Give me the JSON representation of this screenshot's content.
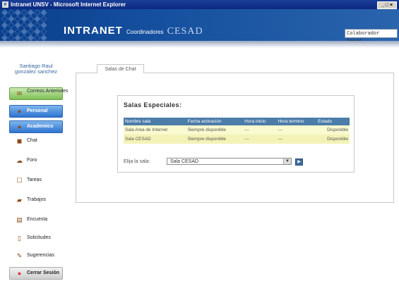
{
  "window": {
    "title": "Intranet UNSV - Microsoft Internet Explorer",
    "controls": "_ □ ×"
  },
  "banner": {
    "brand": "INTRANET",
    "subtitle": "Coordinadores",
    "cesad": "CESAD",
    "user": "Colaborador Cesad"
  },
  "sidebar": {
    "user_name_line1": "Santiago Raul",
    "user_name_line2": "gonzalez sanchez",
    "items": [
      {
        "label": "Correos Anteriores",
        "icon": "mail-icon"
      },
      {
        "label": "Personal",
        "icon": "person-icon"
      },
      {
        "label": "Academico",
        "icon": "book-icon"
      },
      {
        "label": "Chat",
        "icon": "chat-icon"
      },
      {
        "label": "Foro",
        "icon": "forum-icon"
      },
      {
        "label": "Tareas",
        "icon": "tasks-icon"
      },
      {
        "label": "Trabajos",
        "icon": "works-icon"
      },
      {
        "label": "Encuesta",
        "icon": "survey-icon"
      },
      {
        "label": "Solicitudes",
        "icon": "requests-icon"
      },
      {
        "label": "Sugerencias",
        "icon": "suggestions-icon"
      },
      {
        "label": "Cerrar Sesión",
        "icon": "logout-icon"
      }
    ]
  },
  "tab": {
    "label": "Salas de Chat"
  },
  "rooms": {
    "heading": "Salas Especiales:",
    "columns": [
      "Nombre sala",
      "Fecha activación",
      "Hora inicio",
      "Hora termino",
      "Estado"
    ],
    "rows": [
      [
        "Sala Area de Internet",
        "Siempre disponible",
        "---",
        "---",
        "Disponible"
      ],
      [
        "Sala CESAD",
        "Siempre disponible",
        "---",
        "---",
        "Disponible"
      ]
    ],
    "choose_label": "Elija la sala:",
    "selected": "Sala CESAD"
  }
}
